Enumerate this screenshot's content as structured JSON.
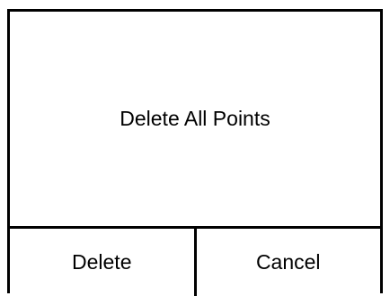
{
  "dialog": {
    "message": "Delete All Points",
    "buttons": {
      "confirm_label": "Delete",
      "cancel_label": "Cancel"
    }
  }
}
